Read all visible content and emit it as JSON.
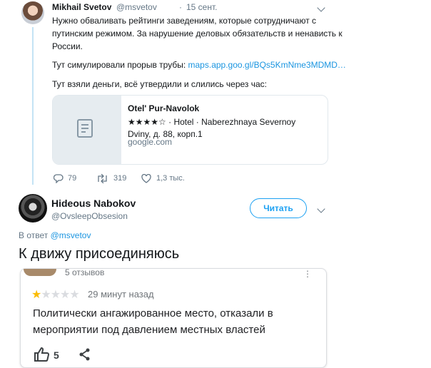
{
  "tweet1": {
    "author_name": "Mikhail Svetov",
    "author_handle": "@msvetov",
    "dot": "·",
    "date": "15 сент.",
    "lines": [
      "Нужно обваливать рейтинги заведениям, которые сотрудничают с",
      "путинским режимом. За нарушение деловых обязательств и ненависть к",
      "России."
    ],
    "pipe_prefix": "Тут симулировали прорыв трубы: ",
    "pipe_link": "maps.app.goo.gl/BQs5KmNme3MDMD…",
    "money_line": "Тут взяли деньги, всё утвердили и слились через час:",
    "card": {
      "title": "Otel' Pur-Navolok",
      "description": "★★★★☆ · Hotel · Naberezhnaya Severnoy Dviny, д. 88, корп.1",
      "url": "google.com",
      "icon": "document-icon"
    },
    "actions": {
      "replies": "79",
      "retweets": "319",
      "likes": "1,3 тыс."
    }
  },
  "tweet2": {
    "author_name": "Hideous Nabokov",
    "author_handle": "@OvsleepObsesion",
    "follow_label": "Читать",
    "reply_prefix": "В ответ ",
    "reply_mention": "@msvetov",
    "text": "К движу присоединяюсь"
  },
  "review": {
    "count": "5 отзывов",
    "more": "⋮",
    "rating": 1,
    "max_rating": 5,
    "time": "29 минут назад",
    "text": "Политически ангажированное место, отказали в мероприятии под давлением местных властей",
    "likes": "5"
  },
  "colors": {
    "accent": "#1da1f2",
    "link": "#1b95e0",
    "star": "#fbbc04",
    "muted": "#657786"
  }
}
